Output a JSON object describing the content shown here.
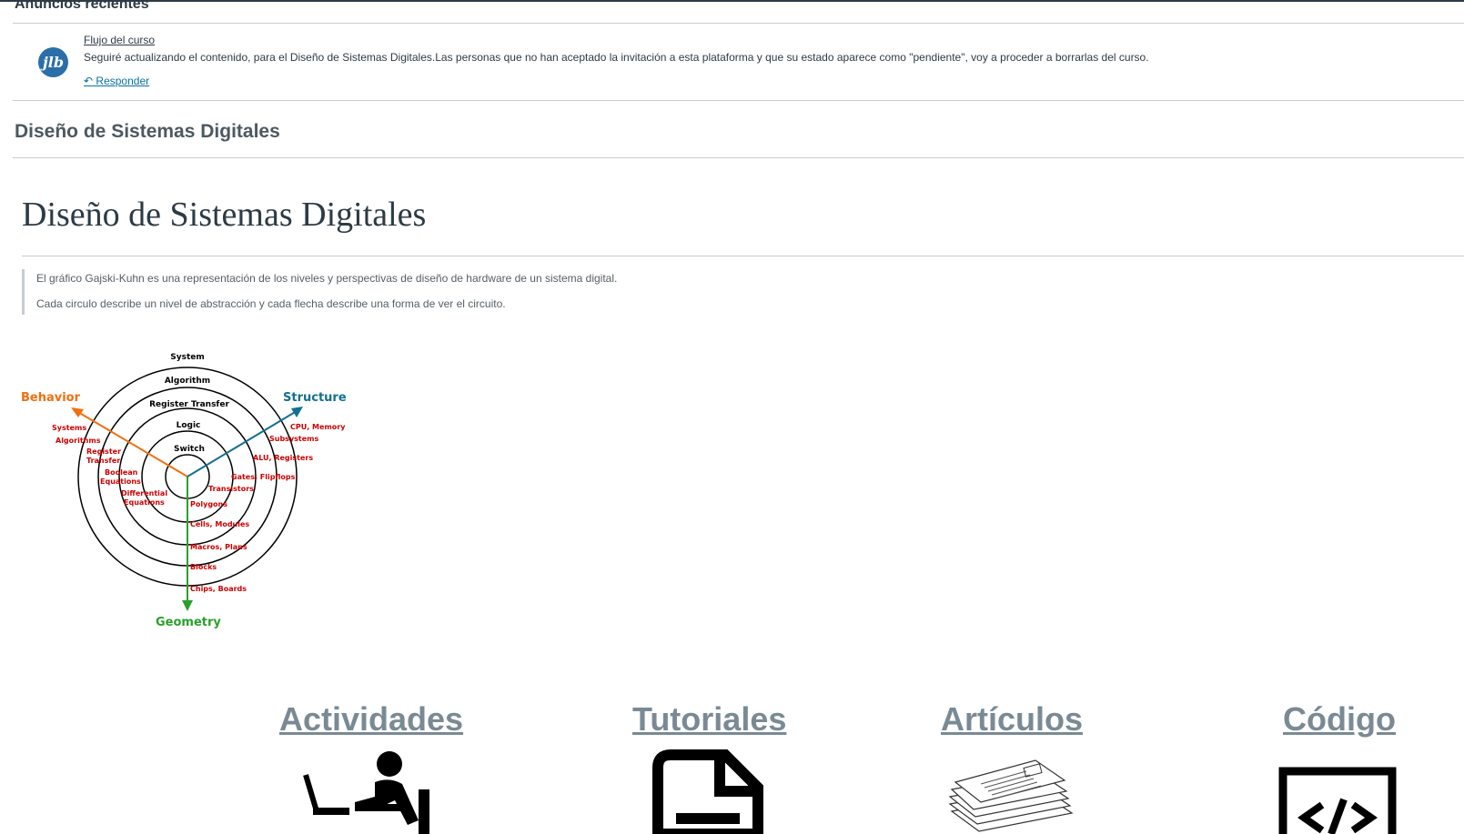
{
  "announcements": {
    "title": "Anuncios recientes",
    "avatar_text": "jlb",
    "item_title": "Flujo del curso",
    "message": "Seguiré actualizando el contenido, para el Diseño de Sistemas Digitales.Las personas que no han aceptado la invitación a esta plataforma y que su estado aparece como \"pendiente\", voy a proceder a borrarlas del curso.",
    "reply_label": "Responder"
  },
  "course": {
    "heading": "Diseño de Sistemas Digitales"
  },
  "page": {
    "title": "Diseño de Sistemas Digitales",
    "quote_lines": [
      "El gráfico Gajski-Kuhn es una representación de los niveles y perspectivas de diseño de hardware de un sistema digital.",
      "Cada circulo describe un nivel de abstracción y cada flecha describe una forma de ver el circuito."
    ]
  },
  "diagram": {
    "levels": [
      "System",
      "Algorithm",
      "Register Transfer",
      "Logic",
      "Switch"
    ],
    "axes": {
      "behavior": "Behavior",
      "structure": "Structure",
      "geometry": "Geometry"
    },
    "behavior_labels": [
      "Systems",
      "Algorithms",
      "Register",
      "Transfer",
      "Boolean",
      "Equations",
      "Differential",
      "Equations"
    ],
    "structure_labels": [
      "CPU, Memory",
      "Subsystems",
      "ALU, Registers",
      "Gates, Flipflops",
      "Transistors"
    ],
    "geometry_labels": [
      "Polygons",
      "Cells, Modules",
      "Macros, Plans",
      "Blocks",
      "Chips, Boards"
    ],
    "colors": {
      "behavior": "#f07010",
      "structure": "#137090",
      "geometry": "#2aa02a",
      "labels": "#cc0000"
    }
  },
  "sections": [
    {
      "label": "Actividades",
      "icon": "person-at-desk-icon"
    },
    {
      "label": "Tutoriales",
      "icon": "document-icon"
    },
    {
      "label": "Artículos",
      "icon": "newspaper-stack-icon"
    },
    {
      "label": "Código",
      "icon": "code-window-icon"
    }
  ]
}
